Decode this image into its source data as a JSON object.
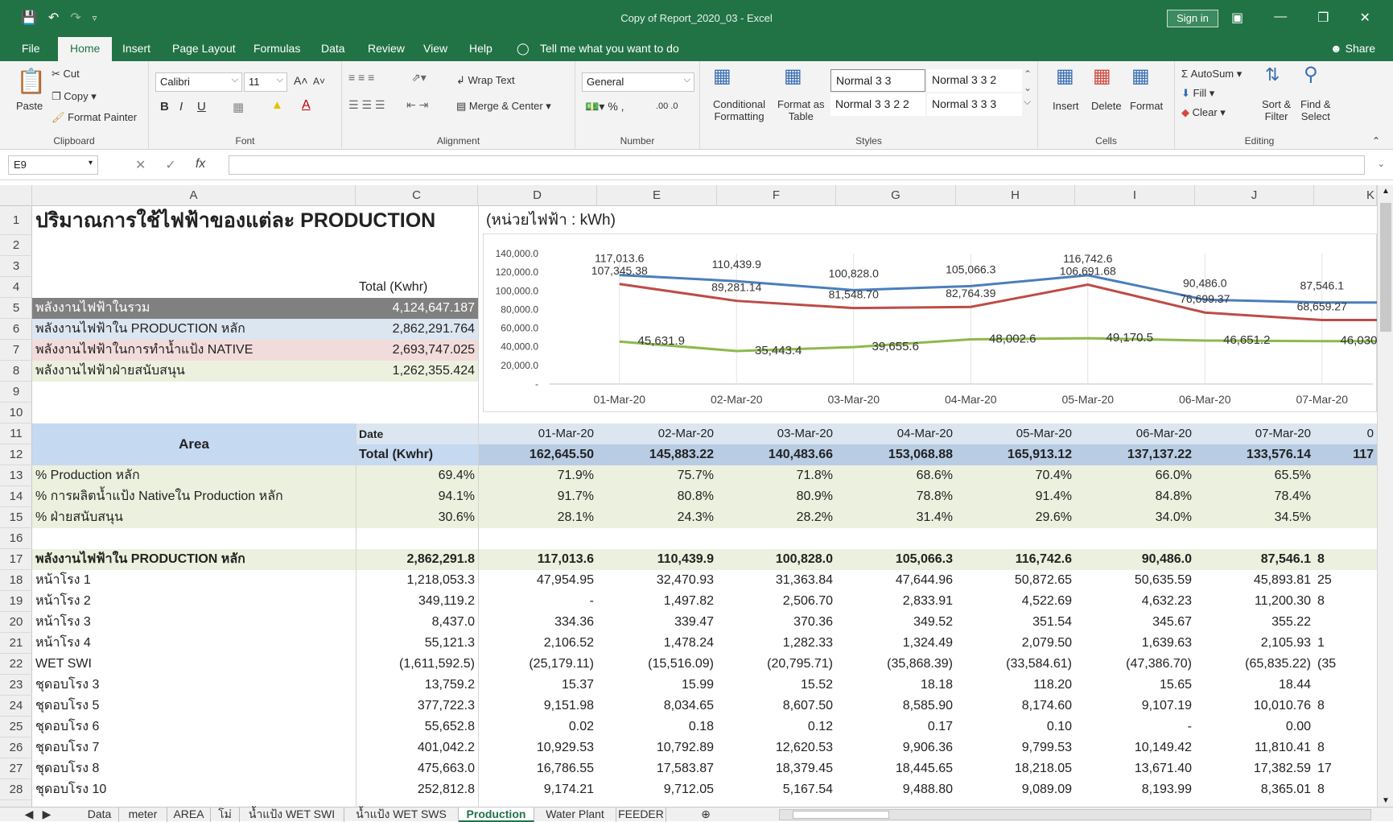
{
  "window": {
    "title": "Copy of Report_2020_03  -  Excel",
    "signin": "Sign in"
  },
  "ribbon_tabs": [
    "File",
    "Home",
    "Insert",
    "Page Layout",
    "Formulas",
    "Data",
    "Review",
    "View",
    "Help"
  ],
  "tell_me": "Tell me what you want to do",
  "share": "Share",
  "clipboard": {
    "paste": "Paste",
    "cut": "Cut",
    "copy": "Copy",
    "format_painter": "Format Painter",
    "label": "Clipboard"
  },
  "font": {
    "name": "Calibri",
    "size": "11",
    "label": "Font"
  },
  "alignment": {
    "wrap": "Wrap Text",
    "merge": "Merge & Center",
    "label": "Alignment"
  },
  "number": {
    "format": "General",
    "label": "Number"
  },
  "styles": {
    "cond": "Conditional",
    "cond2": "Formatting",
    "fmt_table": "Format as",
    "fmt_table2": "Table",
    "s1": "Normal 3 3",
    "s2": "Normal 3 3 2",
    "s3": "Normal 3 3 2 2",
    "s4": "Normal 3 3 3",
    "label": "Styles"
  },
  "cells": {
    "insert": "Insert",
    "delete": "Delete",
    "format": "Format",
    "label": "Cells"
  },
  "editing": {
    "autosum": "AutoSum",
    "fill": "Fill",
    "clear": "Clear",
    "sort": "Sort &",
    "sort2": "Filter",
    "find": "Find &",
    "find2": "Select",
    "label": "Editing"
  },
  "formula_bar": {
    "name_box": "E9",
    "formula": ""
  },
  "columns": [
    "A",
    "C",
    "D",
    "E",
    "F",
    "G",
    "H",
    "I",
    "J",
    "K"
  ],
  "rows": [
    "1",
    "2",
    "3",
    "4",
    "5",
    "6",
    "7",
    "8",
    "9",
    "10",
    "11",
    "12",
    "13",
    "14",
    "15",
    "16",
    "17",
    "18",
    "19",
    "20",
    "21",
    "22",
    "23",
    "24",
    "25",
    "26",
    "27",
    "28"
  ],
  "sheet": {
    "title": "ปริมาณการใช้ไฟฟ้าของแต่ละ PRODUCTION",
    "total_header": "Total (Kwhr)",
    "summary": [
      {
        "label": "พลังงานไฟฟ้าในรวม",
        "value": "4,124,647.187"
      },
      {
        "label": "พลังงานไฟฟ้าใน PRODUCTION หลัก",
        "value": "2,862,291.764"
      },
      {
        "label": "พลังงานไฟฟ้าในการทำน้ำแป้ง NATIVE",
        "value": "2,693,747.025"
      },
      {
        "label": "พลังงานไฟฟ้าฝ่ายสนับสนุน",
        "value": "1,262,355.424"
      }
    ],
    "area": "Area",
    "date_label": "Date",
    "dates": [
      "01-Mar-20",
      "02-Mar-20",
      "03-Mar-20",
      "04-Mar-20",
      "05-Mar-20",
      "06-Mar-20",
      "07-Mar-20",
      "0"
    ],
    "total_label": "Total (Kwhr)",
    "totals": [
      "162,645.50",
      "145,883.22",
      "140,483.66",
      "153,068.88",
      "165,913.12",
      "137,137.22",
      "133,576.14",
      "117"
    ],
    "data_rows": [
      {
        "label": "%  Production หลัก",
        "c": "69.4%",
        "v": [
          "71.9%",
          "75.7%",
          "71.8%",
          "68.6%",
          "70.4%",
          "66.0%",
          "65.5%",
          ""
        ]
      },
      {
        "label": "% การผลิตน้ำแป้ง Nativeใน Production หลัก",
        "c": "94.1%",
        "v": [
          "91.7%",
          "80.8%",
          "80.9%",
          "78.8%",
          "91.4%",
          "84.8%",
          "78.4%",
          ""
        ]
      },
      {
        "label": "%  ฝ่ายสนับสนุน",
        "c": "30.6%",
        "v": [
          "28.1%",
          "24.3%",
          "28.2%",
          "31.4%",
          "29.6%",
          "34.0%",
          "34.5%",
          ""
        ]
      },
      {
        "label": "",
        "c": "",
        "v": [
          "",
          "",
          "",
          "",
          "",
          "",
          "",
          ""
        ]
      },
      {
        "label": "พลังงานไฟฟ้าใน PRODUCTION หลัก",
        "c": "2,862,291.8",
        "v": [
          "117,013.6",
          "110,439.9",
          "100,828.0",
          "105,066.3",
          "116,742.6",
          "90,486.0",
          "87,546.1",
          "8"
        ]
      },
      {
        "label": "หน้าโรง 1",
        "c": "1,218,053.3",
        "v": [
          "47,954.95",
          "32,470.93",
          "31,363.84",
          "47,644.96",
          "50,872.65",
          "50,635.59",
          "45,893.81",
          "25"
        ]
      },
      {
        "label": "หน้าโรง 2",
        "c": "349,119.2",
        "v": [
          "-",
          "1,497.82",
          "2,506.70",
          "2,833.91",
          "4,522.69",
          "4,632.23",
          "11,200.30",
          "8"
        ]
      },
      {
        "label": "หน้าโรง 3",
        "c": "8,437.0",
        "v": [
          "334.36",
          "339.47",
          "370.36",
          "349.52",
          "351.54",
          "345.67",
          "355.22",
          ""
        ]
      },
      {
        "label": "หน้าโรง 4",
        "c": "55,121.3",
        "v": [
          "2,106.52",
          "1,478.24",
          "1,282.33",
          "1,324.49",
          "2,079.50",
          "1,639.63",
          "2,105.93",
          "1"
        ]
      },
      {
        "label": "WET SWI",
        "c": "(1,611,592.5)",
        "v": [
          "(25,179.11)",
          "(15,516.09)",
          "(20,795.71)",
          "(35,868.39)",
          "(33,584.61)",
          "(47,386.70)",
          "(65,835.22)",
          "(35"
        ]
      },
      {
        "label": "ชุดอบโรง 3",
        "c": "13,759.2",
        "v": [
          "15.37",
          "15.99",
          "15.52",
          "18.18",
          "118.20",
          "15.65",
          "18.44",
          ""
        ]
      },
      {
        "label": "ชุดอบโรง 5",
        "c": "377,722.3",
        "v": [
          "9,151.98",
          "8,034.65",
          "8,607.50",
          "8,585.90",
          "8,174.60",
          "9,107.19",
          "10,010.76",
          "8"
        ]
      },
      {
        "label": "ชุดอบโรง 6",
        "c": "55,652.8",
        "v": [
          "0.02",
          "0.18",
          "0.12",
          "0.17",
          "0.10",
          "-",
          "0.00",
          ""
        ]
      },
      {
        "label": "ชุดอบโรง 7",
        "c": "401,042.2",
        "v": [
          "10,929.53",
          "10,792.89",
          "12,620.53",
          "9,906.36",
          "9,799.53",
          "10,149.42",
          "11,810.41",
          "8"
        ]
      },
      {
        "label": "ชุดอบโรง 8",
        "c": "475,663.0",
        "v": [
          "16,786.55",
          "17,583.87",
          "18,379.45",
          "18,445.65",
          "18,218.05",
          "13,671.40",
          "17,382.59",
          "17"
        ]
      },
      {
        "label": "ชุดอบโรง 10",
        "c": "252,812.8",
        "v": [
          "9,174.21",
          "9,712.05",
          "5,167.54",
          "9,488.80",
          "9,089.09",
          "8,193.99",
          "8,365.01",
          "8"
        ]
      }
    ]
  },
  "chart_data": {
    "type": "line",
    "title": "(หน่วยไฟฟ้า : kWh)",
    "categories": [
      "01-Mar-20",
      "02-Mar-20",
      "03-Mar-20",
      "04-Mar-20",
      "05-Mar-20",
      "06-Mar-20",
      "07-Mar-20"
    ],
    "y_ticks": [
      "140,000.0",
      "120,000.0",
      "100,000.0",
      "80,000.0",
      "60,000.0",
      "40,000.0",
      "20,000.0",
      "-"
    ],
    "ylim": [
      0,
      140000
    ],
    "series": [
      {
        "values": [
          117013.6,
          110439.9,
          100828.0,
          105066.3,
          116742.6,
          90486.0,
          87546.1
        ],
        "labels": [
          "117,013.6",
          "110,439.9",
          "100,828.0",
          "105,066.3",
          "116,742.6",
          "90,486.0",
          "87,546.1"
        ],
        "color": "#4a7ebb"
      },
      {
        "values": [
          107345.38,
          89281.14,
          81548.7,
          82764.39,
          106691.68,
          76699.37,
          68659.27
        ],
        "labels": [
          "107,345.38",
          "89,281.14",
          "81,548.70",
          "82,764.39",
          "106,691.68",
          "76,699.37",
          "68,659.27"
        ],
        "color": "#be4b48"
      },
      {
        "values": [
          45631.9,
          35443.4,
          39655.6,
          48002.6,
          49170.5,
          46651.2,
          46030.0
        ],
        "labels": [
          "45,631.9",
          "35,443.4",
          "39,655.6",
          "48,002.6",
          "49,170.5",
          "46,651.2",
          "46,030.0"
        ],
        "color": "#8db94a"
      }
    ],
    "grid": true
  },
  "sheet_tabs": [
    "Data",
    "meter",
    "AREA",
    "โม่",
    "น้ำแป้ง WET SWI",
    "น้ำแป้ง WET SWS",
    "Production",
    "Water Plant",
    "FEEDER"
  ],
  "active_sheet": "Production"
}
